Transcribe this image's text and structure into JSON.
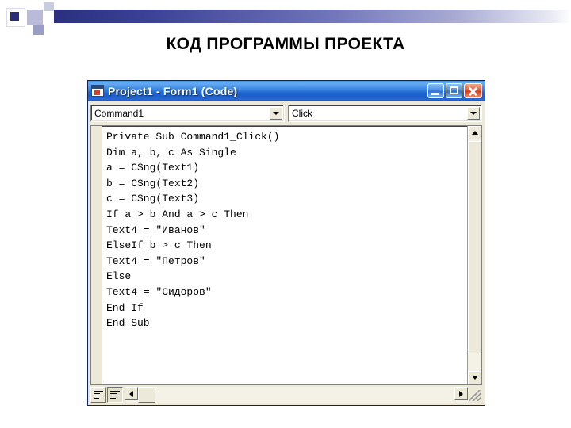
{
  "slide": {
    "title": "КОД ПРОГРАММЫ ПРОЕКТА",
    "decoration": {
      "bar_color_start": "#2b2f7e",
      "bar_color_end": "#ffffff",
      "square_color": "#2a2d7c"
    }
  },
  "window": {
    "title": "Project1 - Form1 (Code)",
    "titlebar_color": "#1e63cf",
    "icon": "vb-code-icon",
    "controls": {
      "minimize": "Minimize",
      "maximize": "Maximize",
      "close": "Close"
    }
  },
  "editor": {
    "object_combo": {
      "value": "Command1",
      "label": "Object"
    },
    "procedure_combo": {
      "value": "Click",
      "label": "Procedure"
    },
    "code_lines": [
      "Private Sub Command1_Click()",
      "Dim a, b, c As Single",
      "a = CSng(Text1)",
      "b = CSng(Text2)",
      "c = CSng(Text3)",
      "If a > b And a > c Then",
      "Text4 = \"Иванов\"",
      "ElseIf b > c Then",
      "Text4 = \"Петров\"",
      "Else",
      "Text4 = \"Сидоров\"",
      "End If",
      "End Sub"
    ],
    "caret_line": 11,
    "bottom_bar": {
      "procedure_view": "Procedure View",
      "full_module_view": "Full Module View"
    },
    "scrollbars": {
      "vertical_up": "Scroll Up",
      "vertical_down": "Scroll Down",
      "horizontal_left": "Scroll Left",
      "horizontal_right": "Scroll Right"
    },
    "resize_grip": "Resize"
  }
}
